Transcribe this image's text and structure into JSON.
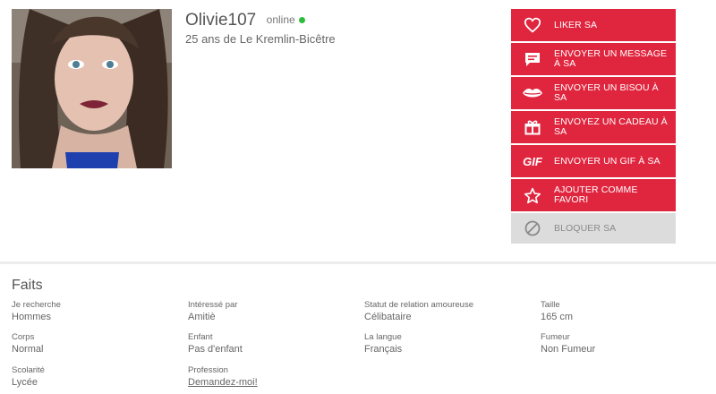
{
  "profile": {
    "username": "Olivie107",
    "status": "online",
    "subtitle": "25 ans de Le Kremlin-Bicêtre",
    "status_color": "#2dbd3a"
  },
  "actions": [
    {
      "label": "LIKER SA",
      "icon": "heart-icon"
    },
    {
      "label": "ENVOYER UN MESSAGE À SA",
      "icon": "chat-icon"
    },
    {
      "label": "ENVOYER UN BISOU À SA",
      "icon": "lips-icon"
    },
    {
      "label": "ENVOYEZ UN CADEAU À SA",
      "icon": "gift-icon"
    },
    {
      "label": "ENVOYER UN GIF À SA",
      "icon": "gif-icon",
      "icon_text": "GIF"
    },
    {
      "label": "AJOUTER COMME FAVORI",
      "icon": "star-icon"
    },
    {
      "label": "BLOQUER SA",
      "icon": "block-icon"
    }
  ],
  "colors": {
    "accent": "#e0263f",
    "disabled": "#dcdcdc"
  },
  "facts": {
    "title": "Faits",
    "items": [
      {
        "label": "Je recherche",
        "value": "Hommes"
      },
      {
        "label": "Intéressé par",
        "value": "Amitiè"
      },
      {
        "label": "Statut de relation amoureuse",
        "value": "Célibataire"
      },
      {
        "label": "Taille",
        "value": "165 cm"
      },
      {
        "label": "Corps",
        "value": "Normal"
      },
      {
        "label": "Enfant",
        "value": "Pas d'enfant"
      },
      {
        "label": "La langue",
        "value": "Français"
      },
      {
        "label": "Fumeur",
        "value": "Non Fumeur"
      },
      {
        "label": "Scolarité",
        "value": "Lycée"
      },
      {
        "label": "Profession",
        "value": "Demandez-moi!"
      }
    ]
  }
}
